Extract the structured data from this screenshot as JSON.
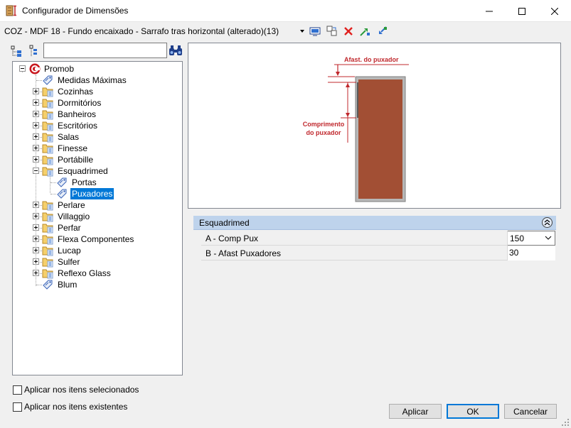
{
  "window": {
    "title": "Configurador de Dimensões"
  },
  "toolbar": {
    "item_title": "COZ - MDF 18 - Fundo encaixado - Sarrafo tras horizontal (alterado)(13)"
  },
  "search": {
    "value": "",
    "placeholder": ""
  },
  "tree": {
    "root": "Promob",
    "nodes": [
      {
        "label": "Medidas Máximas"
      },
      {
        "label": "Cozinhas"
      },
      {
        "label": "Dormitórios"
      },
      {
        "label": "Banheiros"
      },
      {
        "label": "Escritórios"
      },
      {
        "label": "Salas"
      },
      {
        "label": "Finesse"
      },
      {
        "label": "Portábille"
      },
      {
        "label": "Esquadrimed"
      },
      {
        "label": "Portas"
      },
      {
        "label": "Puxadores"
      },
      {
        "label": "Perlare"
      },
      {
        "label": "Villaggio"
      },
      {
        "label": "Perfar"
      },
      {
        "label": "Flexa Componentes"
      },
      {
        "label": "Lucap"
      },
      {
        "label": "Sulfer"
      },
      {
        "label": "Reflexo Glass"
      },
      {
        "label": "Blum"
      }
    ]
  },
  "preview": {
    "label_afast": "Afast. do puxador",
    "label_comp_1": "Comprimento",
    "label_comp_2": "do puxador",
    "accent_color": "#c0282d",
    "door_color": "#a24f34"
  },
  "properties": {
    "group": "Esquadrimed",
    "rows": [
      {
        "name": "A -  Comp Pux",
        "value": "150"
      },
      {
        "name": "B -  Afast Puxadores",
        "value": "30"
      }
    ]
  },
  "options": {
    "apply_selected": "Aplicar nos itens selecionados",
    "apply_existing": "Aplicar nos itens existentes"
  },
  "buttons": {
    "apply": "Aplicar",
    "ok": "OK",
    "cancel": "Cancelar"
  }
}
